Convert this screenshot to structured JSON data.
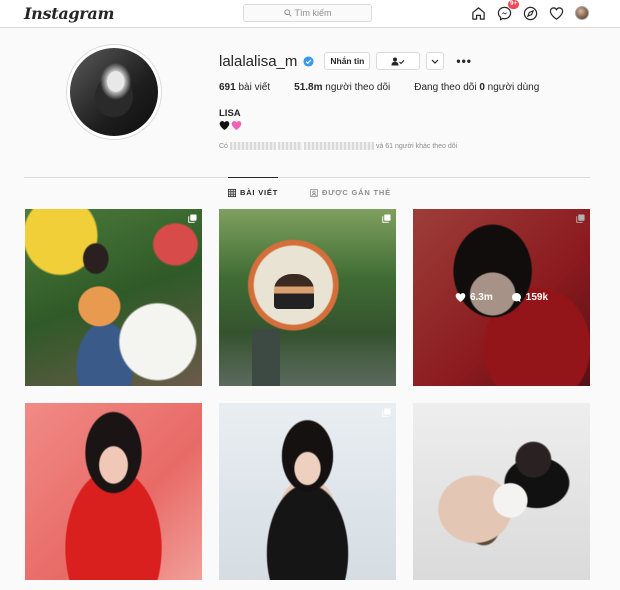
{
  "nav": {
    "logo": "Instagram",
    "search_placeholder": "Tìm kiếm",
    "notification_badge": "9+"
  },
  "profile": {
    "username": "lalalalisa_m",
    "verified": true,
    "message_button": "Nhắn tin",
    "stats": [
      {
        "value": "691",
        "label": " bài viết"
      },
      {
        "value": "51.8m",
        "label": " người theo dõi"
      },
      {
        "prefix": "Đang theo dõi ",
        "value": "0",
        "label": " người dùng"
      }
    ],
    "full_name": "LISA",
    "followed_by_prefix": "Có",
    "followed_by_suffix": "và 61 người khác theo dõi"
  },
  "tabs": [
    {
      "label": "BÀI VIẾT",
      "active": true
    },
    {
      "label": "ĐƯỢC GẮN THẺ",
      "active": false
    }
  ],
  "posts": [
    {
      "multi": true
    },
    {
      "multi": true
    },
    {
      "multi": true,
      "hovered": true,
      "likes": "6.3m",
      "comments": "159k"
    },
    {
      "multi": false
    },
    {
      "multi": true
    },
    {
      "multi": false
    }
  ],
  "colors": {
    "accent": "#3897f0",
    "badge": "#ed4956",
    "bio_heart_black": "#111111",
    "bio_heart_pink": "#f062b8"
  }
}
